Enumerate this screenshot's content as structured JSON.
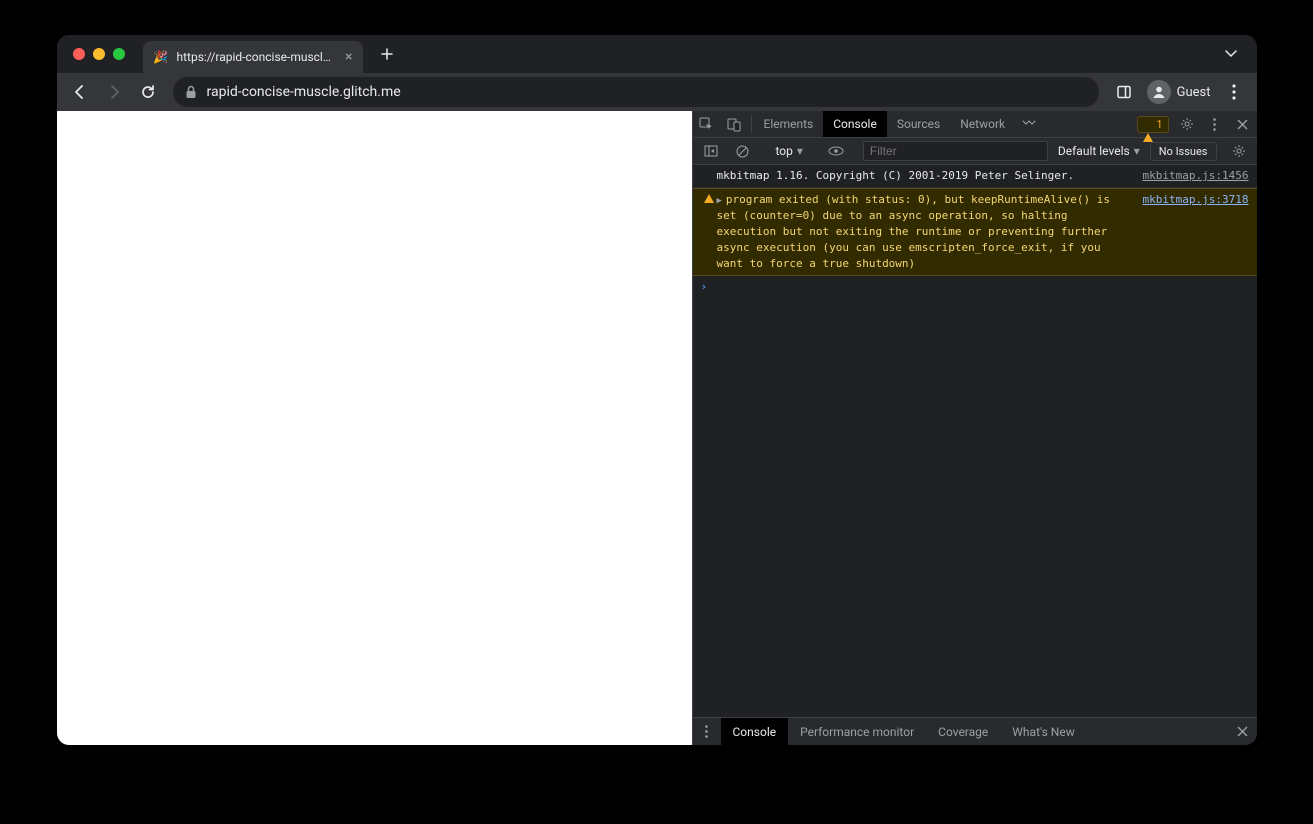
{
  "tab": {
    "title": "https://rapid-concise-muscle.g",
    "favicon": "🎉"
  },
  "toolbar": {
    "url": "rapid-concise-muscle.glitch.me",
    "guest_label": "Guest"
  },
  "devtools": {
    "tabs": {
      "elements": "Elements",
      "console": "Console",
      "sources": "Sources",
      "network": "Network"
    },
    "warning_count": "1",
    "console_toolbar": {
      "context": "top",
      "filter_placeholder": "Filter",
      "levels": "Default levels",
      "issues": "No Issues"
    },
    "logs": [
      {
        "level": "log",
        "message": "mkbitmap 1.16. Copyright (C) 2001-2019 Peter Selinger.",
        "source": "mkbitmap.js:1456"
      },
      {
        "level": "warn",
        "message": "program exited (with status: 0), but keepRuntimeAlive() is set (counter=0) due to an async operation, so halting execution but not exiting the runtime or preventing further async execution (you can use emscripten_force_exit, if you want to force a true shutdown)",
        "source": "mkbitmap.js:3718"
      }
    ],
    "drawer": {
      "console": "Console",
      "perfmon": "Performance monitor",
      "coverage": "Coverage",
      "whatsnew": "What's New"
    }
  }
}
